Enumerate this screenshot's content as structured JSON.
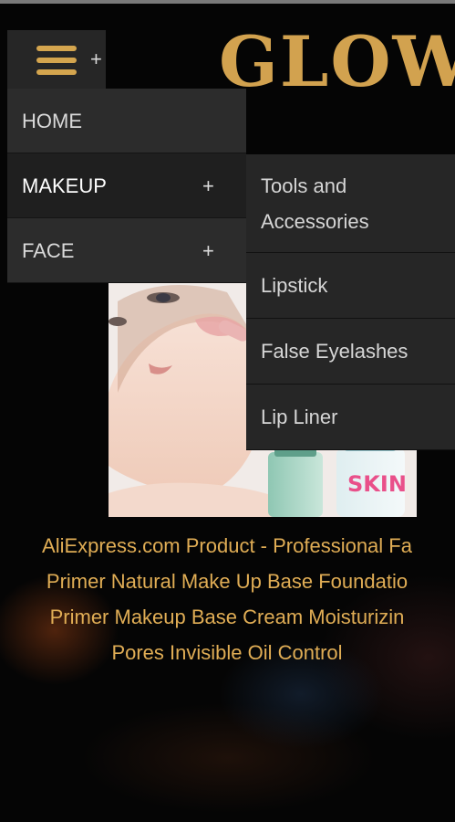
{
  "header": {
    "logo_text": "GLOW",
    "menu_toggle_plus": "+"
  },
  "nav": {
    "items": [
      {
        "label": "HOME",
        "has_submenu": false
      },
      {
        "label": "MAKEUP",
        "has_submenu": true,
        "plus": "+",
        "expanded": true
      },
      {
        "label": "FACE",
        "has_submenu": true,
        "plus": "+"
      }
    ]
  },
  "submenu": {
    "items": [
      {
        "label": "Tools and Accessories"
      },
      {
        "label": "Lipstick"
      },
      {
        "label": "False Eyelashes"
      },
      {
        "label": "Lip Liner"
      }
    ]
  },
  "product": {
    "image_text": "SKIN",
    "caption_lines": [
      "AliExpress.com Product - Professional Fa",
      "Primer Natural Make Up Base Foundatio",
      "Primer Makeup Base Cream Moisturizin",
      "Pores Invisible Oil Control"
    ]
  },
  "colors": {
    "accent_gold": "#d4a54e",
    "caption_gold": "#e0ad55",
    "menu_bg": "#2c2c2c",
    "menu_active_bg": "#1f1f1f",
    "submenu_bg": "#262626",
    "page_bg": "#050505"
  }
}
